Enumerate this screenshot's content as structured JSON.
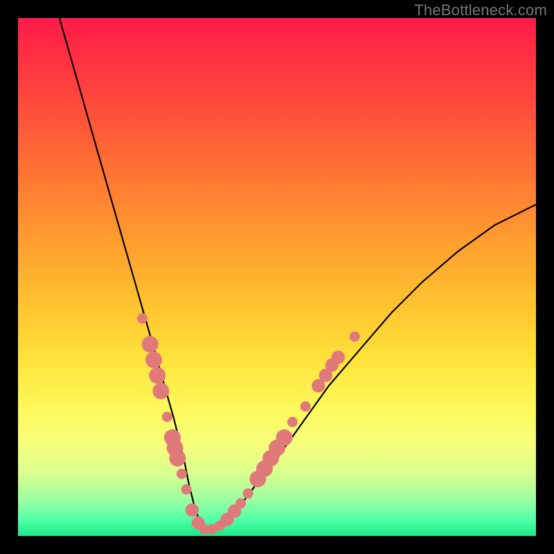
{
  "watermark": "TheBottleneck.com",
  "colors": {
    "background": "#000000",
    "curve_stroke": "#000000",
    "marker_fill": "#e07a7a",
    "gradient_top": "#ff1a49",
    "gradient_bottom": "#16e884"
  },
  "chart_data": {
    "type": "line",
    "title": "",
    "xlabel": "",
    "ylabel": "",
    "xlim": [
      0,
      100
    ],
    "ylim": [
      0,
      100
    ],
    "annotations": [],
    "series": [
      {
        "name": "curve",
        "x": [
          8,
          10,
          12,
          14,
          16,
          18,
          20,
          22,
          24,
          26,
          28,
          30,
          32,
          33,
          34,
          35,
          36,
          38,
          40,
          43,
          46,
          50,
          55,
          60,
          66,
          72,
          78,
          85,
          92,
          100
        ],
        "y": [
          100,
          93,
          86,
          79,
          72,
          65,
          58,
          51,
          44,
          37,
          30,
          23,
          15,
          10,
          6,
          3,
          1.5,
          1.5,
          3,
          6,
          10,
          15,
          22,
          29,
          36,
          43,
          49,
          55,
          60,
          64
        ]
      }
    ],
    "markers": [
      {
        "x": 24.0,
        "y": 42,
        "r": 1.0
      },
      {
        "x": 25.5,
        "y": 37,
        "r": 1.6
      },
      {
        "x": 26.2,
        "y": 34,
        "r": 1.6
      },
      {
        "x": 26.9,
        "y": 31,
        "r": 1.6
      },
      {
        "x": 27.6,
        "y": 28,
        "r": 1.6
      },
      {
        "x": 28.8,
        "y": 23,
        "r": 1.0
      },
      {
        "x": 29.8,
        "y": 19,
        "r": 1.6
      },
      {
        "x": 30.3,
        "y": 17,
        "r": 1.6
      },
      {
        "x": 30.8,
        "y": 15,
        "r": 1.6
      },
      {
        "x": 31.6,
        "y": 12,
        "r": 1.0
      },
      {
        "x": 32.5,
        "y": 9,
        "r": 1.0
      },
      {
        "x": 33.6,
        "y": 5,
        "r": 1.3
      },
      {
        "x": 34.8,
        "y": 2.5,
        "r": 1.3
      },
      {
        "x": 36.0,
        "y": 1.3,
        "r": 1.0
      },
      {
        "x": 37.5,
        "y": 1.3,
        "r": 1.0
      },
      {
        "x": 39.0,
        "y": 2,
        "r": 1.0
      },
      {
        "x": 40.4,
        "y": 3.2,
        "r": 1.3
      },
      {
        "x": 41.8,
        "y": 4.8,
        "r": 1.3
      },
      {
        "x": 43.0,
        "y": 6.3,
        "r": 1.0
      },
      {
        "x": 44.4,
        "y": 8.2,
        "r": 1.0
      },
      {
        "x": 46.3,
        "y": 11,
        "r": 1.6
      },
      {
        "x": 47.6,
        "y": 13,
        "r": 1.6
      },
      {
        "x": 48.8,
        "y": 15,
        "r": 1.6
      },
      {
        "x": 50.0,
        "y": 17,
        "r": 1.6
      },
      {
        "x": 51.4,
        "y": 19,
        "r": 1.6
      },
      {
        "x": 53.0,
        "y": 22,
        "r": 1.0
      },
      {
        "x": 55.5,
        "y": 25,
        "r": 1.0
      },
      {
        "x": 58.0,
        "y": 29,
        "r": 1.3
      },
      {
        "x": 59.4,
        "y": 31,
        "r": 1.3
      },
      {
        "x": 60.6,
        "y": 33,
        "r": 1.3
      },
      {
        "x": 61.8,
        "y": 34.5,
        "r": 1.3
      },
      {
        "x": 65.0,
        "y": 38.5,
        "r": 1.0
      }
    ]
  }
}
